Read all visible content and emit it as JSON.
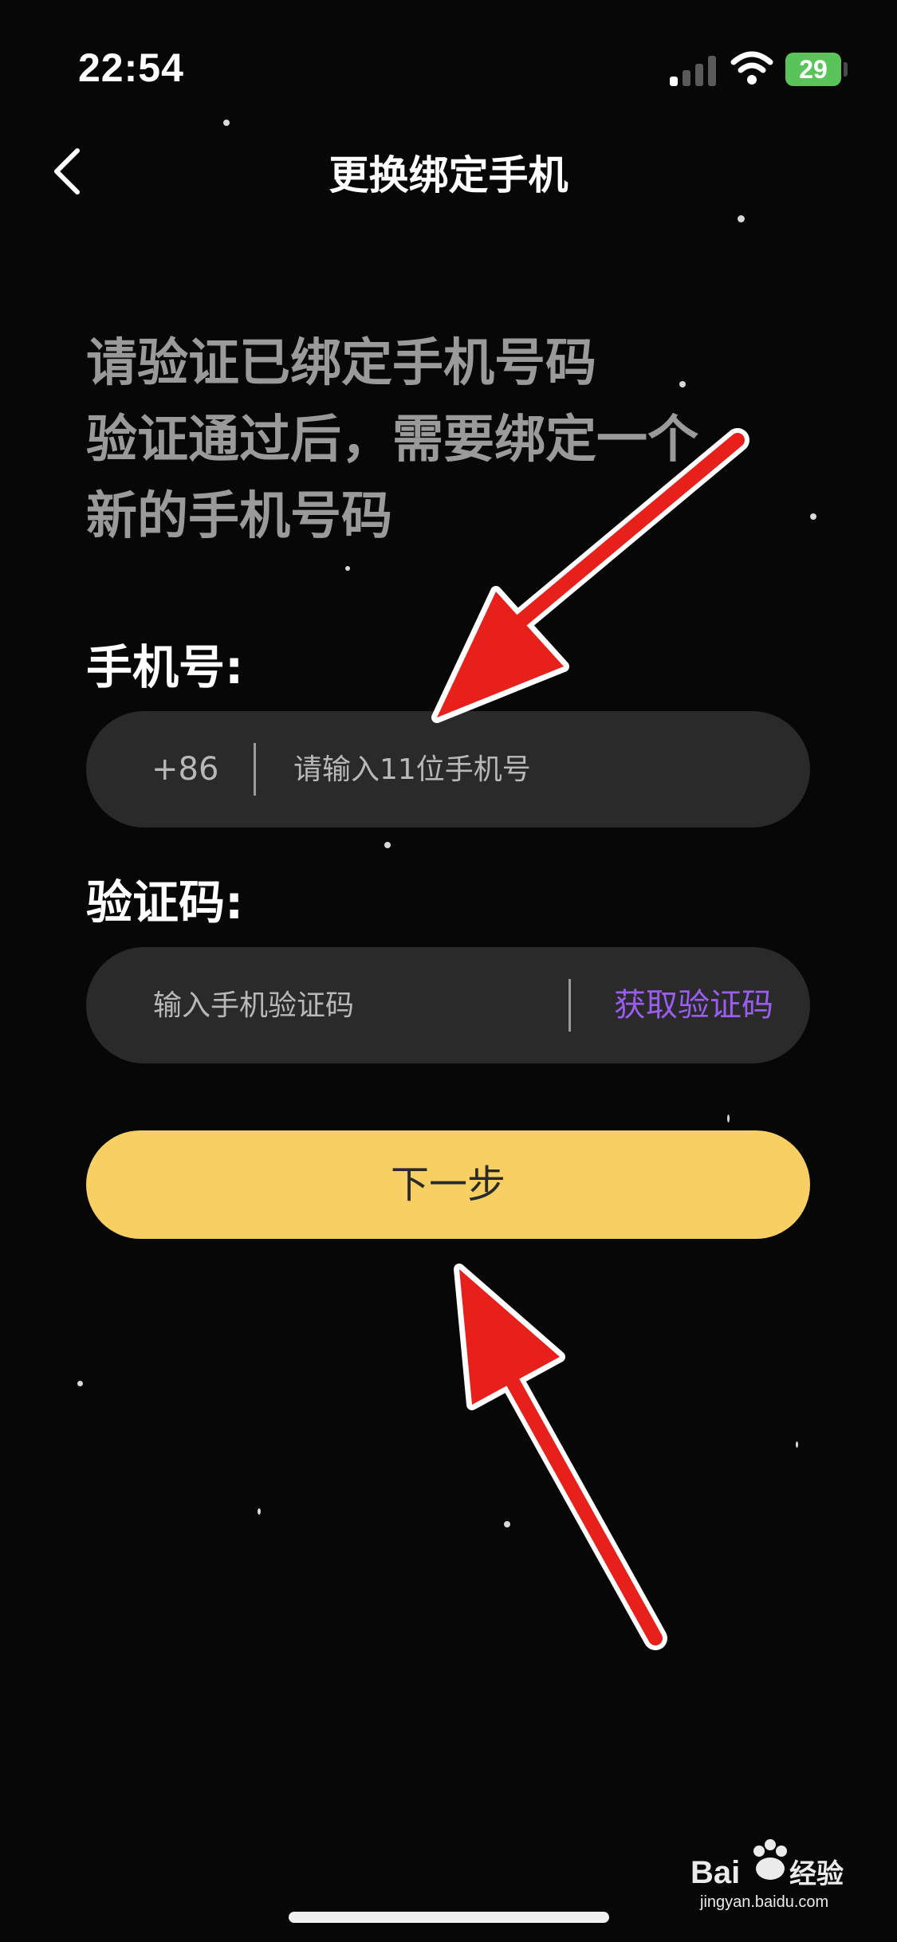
{
  "status_bar": {
    "time": "22:54",
    "battery": "29"
  },
  "nav": {
    "back_icon": "chevron-left-icon",
    "title": "更换绑定手机"
  },
  "instruction": {
    "lines": [
      "请验证已绑定手机号码",
      "验证通过后，需要绑定一个",
      "新的手机号码"
    ]
  },
  "phone_field": {
    "label": "手机号:",
    "country_code": "+86",
    "placeholder": "请输入11位手机号"
  },
  "code_field": {
    "label": "验证码:",
    "placeholder": "输入手机验证码",
    "get_code_label": "获取验证码"
  },
  "next_button": {
    "label": "下一步"
  },
  "colors": {
    "background": "#070707",
    "field_bg": "#2a2a2a",
    "accent_purple": "#9a5df0",
    "button_yellow": "#f7cf63",
    "arrow_red": "#e8201c"
  }
}
